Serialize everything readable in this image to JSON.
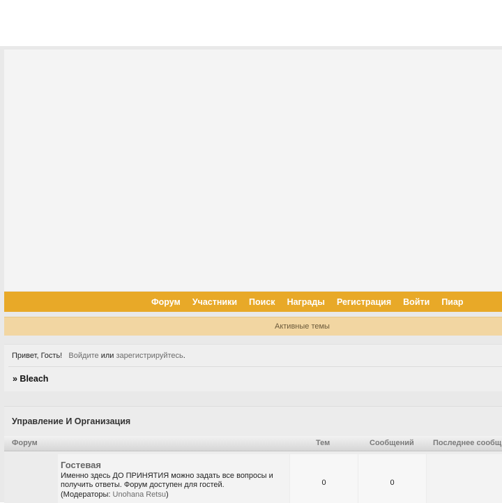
{
  "nav": {
    "items": [
      {
        "label": "Форум"
      },
      {
        "label": "Участники"
      },
      {
        "label": "Поиск"
      },
      {
        "label": "Награды"
      },
      {
        "label": "Регистрация"
      },
      {
        "label": "Войти"
      },
      {
        "label": "Пиар"
      }
    ]
  },
  "active_topics": {
    "label": "Активные темы"
  },
  "welcome": {
    "greeting": "Привет, Гость!",
    "login_link": "Войдите",
    "or_text": "или",
    "register_link": "зарегистрируйтесь",
    "period": "."
  },
  "breadcrumb": {
    "label": "» Bleach"
  },
  "category": {
    "title": "Управление И Организация",
    "columns": {
      "forum": "Форум",
      "topics": "Тем",
      "posts": "Сообщений",
      "last_post": "Последнее сообщ"
    },
    "forums": [
      {
        "name": "Гостевая",
        "description": "Именно здесь ДО ПРИНЯТИЯ можно задать все вопросы и получить ответы. Форум доступен для гостей.",
        "moderators_prefix": "(Модераторы: ",
        "moderator": "Unohana Retsu",
        "moderators_suffix": ")",
        "topics": "0",
        "posts": "0"
      }
    ]
  },
  "colors": {
    "nav_bg": "#e8a928",
    "active_bar_bg": "#f2d6a2",
    "page_bg": "#e9e9e9"
  }
}
